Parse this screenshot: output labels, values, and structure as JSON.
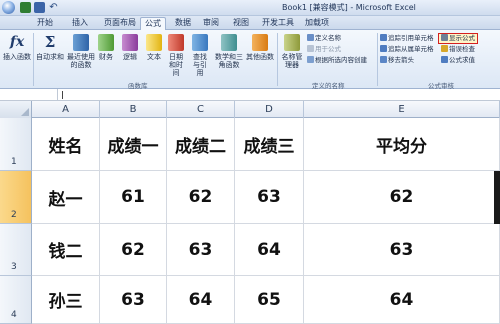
{
  "window": {
    "title": "Book1 [兼容模式] - Microsoft Excel",
    "undo_glyph": "↶"
  },
  "tabs": [
    "开始",
    "插入",
    "页面布局",
    "公式",
    "数据",
    "审阅",
    "视图",
    "开发工具",
    "加载项"
  ],
  "active_tab": "公式",
  "ribbon": {
    "insert_function": {
      "glyph": "fx",
      "label": "插入函数"
    },
    "autosum": {
      "glyph": "Σ",
      "label": "自动求和"
    },
    "recent": {
      "label": "最近使用的函数"
    },
    "financial": {
      "label": "财务"
    },
    "logical": {
      "label": "逻辑"
    },
    "text": {
      "label": "文本"
    },
    "datetime": {
      "label": "日期和时间"
    },
    "lookup": {
      "label": "查找与引用"
    },
    "math": {
      "label": "数学和三角函数"
    },
    "more": {
      "label": "其他函数"
    },
    "function_library_label": "函数库",
    "name_manager": {
      "label": "名称管理器"
    },
    "define_name": "定义名称",
    "use_in_formula": "用于公式",
    "create_from_selection": "根据所选内容创建",
    "defined_names_label": "定义的名称",
    "trace_precedents": "追踪引用单元格",
    "trace_dependents": "追踪从属单元格",
    "remove_arrows": "移去箭头",
    "show_formulas": "显示公式",
    "error_checking": "错误检查",
    "evaluate_formula": "公式求值",
    "formula_auditing_label": "公式审核"
  },
  "sheet": {
    "corner": "",
    "columns": [
      "A",
      "B",
      "C",
      "D",
      "E"
    ],
    "rows": [
      {
        "num": "1",
        "cells": [
          "姓名",
          "成绩一",
          "成绩二",
          "成绩三",
          "平均分"
        ]
      },
      {
        "num": "2",
        "cells": [
          "赵一",
          "61",
          "62",
          "63",
          "62"
        ]
      },
      {
        "num": "3",
        "cells": [
          "钱二",
          "62",
          "63",
          "64",
          "63"
        ]
      },
      {
        "num": "4",
        "cells": [
          "孙三",
          "63",
          "64",
          "65",
          "64"
        ]
      }
    ],
    "selected_row": "2"
  }
}
